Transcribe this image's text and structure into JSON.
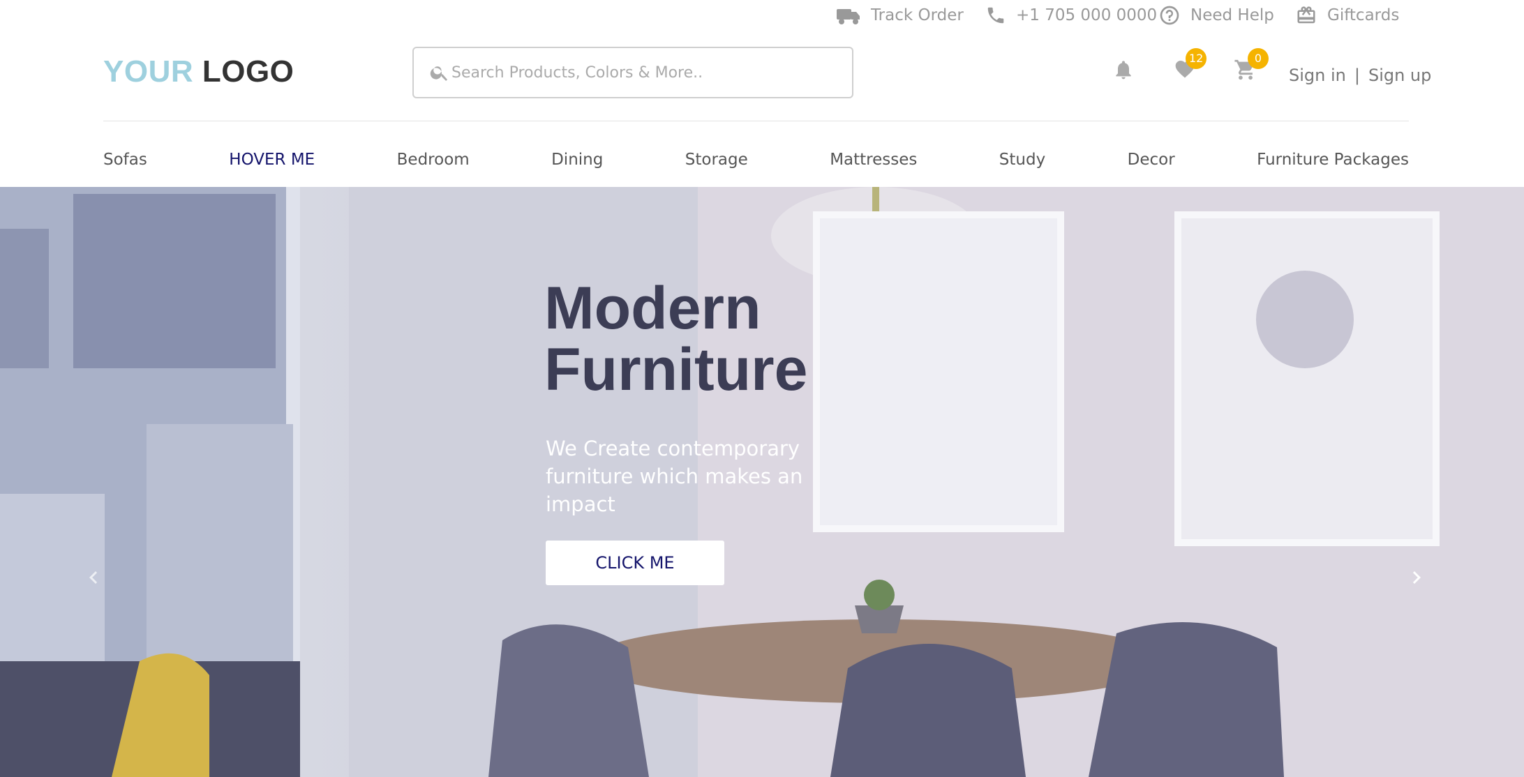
{
  "topbar": {
    "track_order": "Track Order",
    "phone": "+1 705 000 0000",
    "need_help": "Need Help",
    "giftcards": "Giftcards"
  },
  "logo": {
    "part1": "YOUR",
    "part2": "LOGO"
  },
  "search": {
    "placeholder": "Search Products, Colors & More..",
    "value": ""
  },
  "header_icons": {
    "notifications": "bell-icon",
    "wishlist": "heart-icon",
    "wishlist_count": "12",
    "cart": "cart-icon",
    "cart_count": "0"
  },
  "auth": {
    "sign_in": "Sign in",
    "separator": "|",
    "sign_up": "Sign up"
  },
  "categories": [
    "Sofas",
    "HOVER ME",
    "Bedroom",
    "Dining",
    "Storage",
    "Mattresses",
    "Study",
    "Decor",
    "Furniture Packages"
  ],
  "hero": {
    "title_line1": "Modern",
    "title_line2": "Furniture",
    "subtitle": "We Create contemporary furniture which makes an impact",
    "button": "CLICK ME",
    "prev_icon": "chevron-left-icon",
    "next_icon": "chevron-right-icon"
  },
  "colors": {
    "accent_nav": "#14146b",
    "logo_light": "#9ed0de",
    "logo_dark": "#333333",
    "badge": "#f5b301",
    "hero_title": "#3c3d55"
  }
}
